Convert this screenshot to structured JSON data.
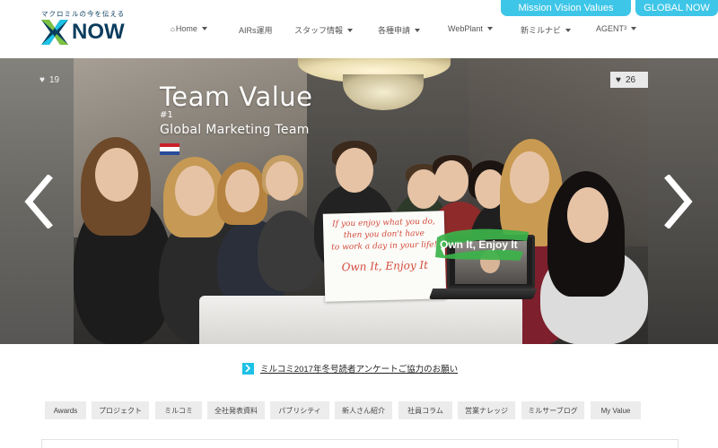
{
  "top_links": {
    "mission": "Mission Vision Values",
    "global": "GLOBAL NOW"
  },
  "logo": {
    "tagline": "マクロミルの今を伝える",
    "word": "NOW"
  },
  "nav": {
    "items": [
      {
        "label": "Home",
        "icon": "home-icon",
        "has_caret": true
      },
      {
        "label": "AIRs運用",
        "has_caret": false
      },
      {
        "label": "スタッフ情報",
        "has_caret": true
      },
      {
        "label": "各種申請",
        "has_caret": true
      },
      {
        "label": "WebPlant",
        "has_caret": true
      },
      {
        "label": "新ミルナビ",
        "has_caret": true
      },
      {
        "label": "AGENT",
        "sup": "3",
        "has_caret": true
      }
    ]
  },
  "hero": {
    "title": "Team Value",
    "number": "#1",
    "subtitle": "Global Marketing Team",
    "sign_lines": [
      "If you enjoy what you do,",
      "then you don't have",
      "to work a day in your life!"
    ],
    "sign_footer": "Own It, Enjoy It",
    "green_label": "Own It, Enjoy It",
    "like_left": "19",
    "like_right": "26",
    "green_color": "#3cb34a"
  },
  "announcement": {
    "text": "ミルコミ2017年冬号読者アンケートご協力のお願い"
  },
  "categories": [
    "Awards",
    "プロジェクト",
    "ミルコミ",
    "全社発表資料",
    "パブリシティ",
    "新人さん紹介",
    "社員コラム",
    "営業ナレッジ",
    "ミルサーブログ",
    "My Value"
  ],
  "colors": {
    "accent": "#3ec6e8",
    "brand_navy": "#0b3c5d"
  }
}
